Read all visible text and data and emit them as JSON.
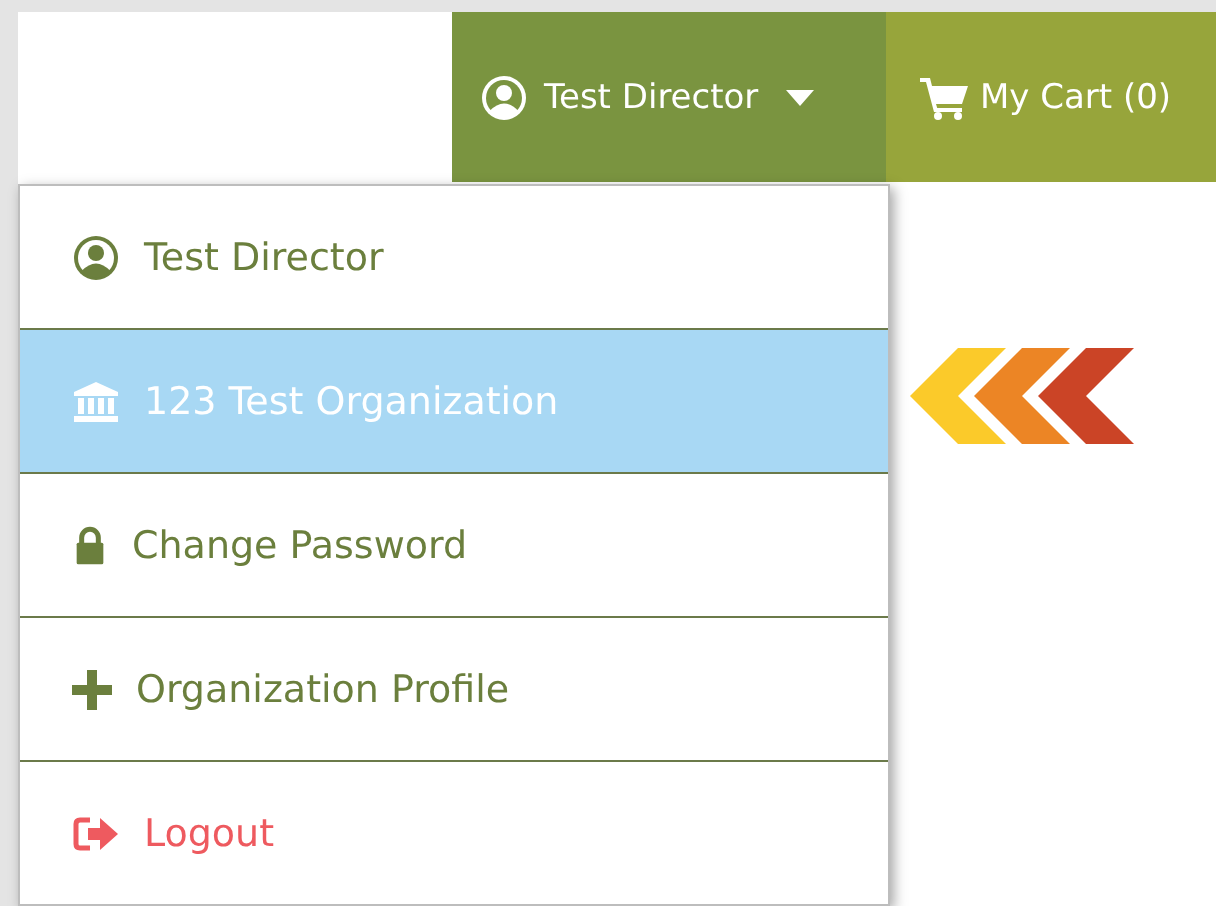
{
  "header": {
    "user_menu": {
      "label": "Test Director",
      "expanded": true
    },
    "cart": {
      "label": "My Cart (0)"
    }
  },
  "menu": [
    {
      "kind": "user",
      "label": "Test Director",
      "selected": false
    },
    {
      "kind": "organization",
      "label": "123 Test Organization",
      "selected": true
    },
    {
      "kind": "lock",
      "label": "Change Password",
      "selected": false
    },
    {
      "kind": "plus",
      "label": "Organization Profile",
      "selected": false
    },
    {
      "kind": "logout",
      "label": "Logout",
      "selected": false
    }
  ]
}
